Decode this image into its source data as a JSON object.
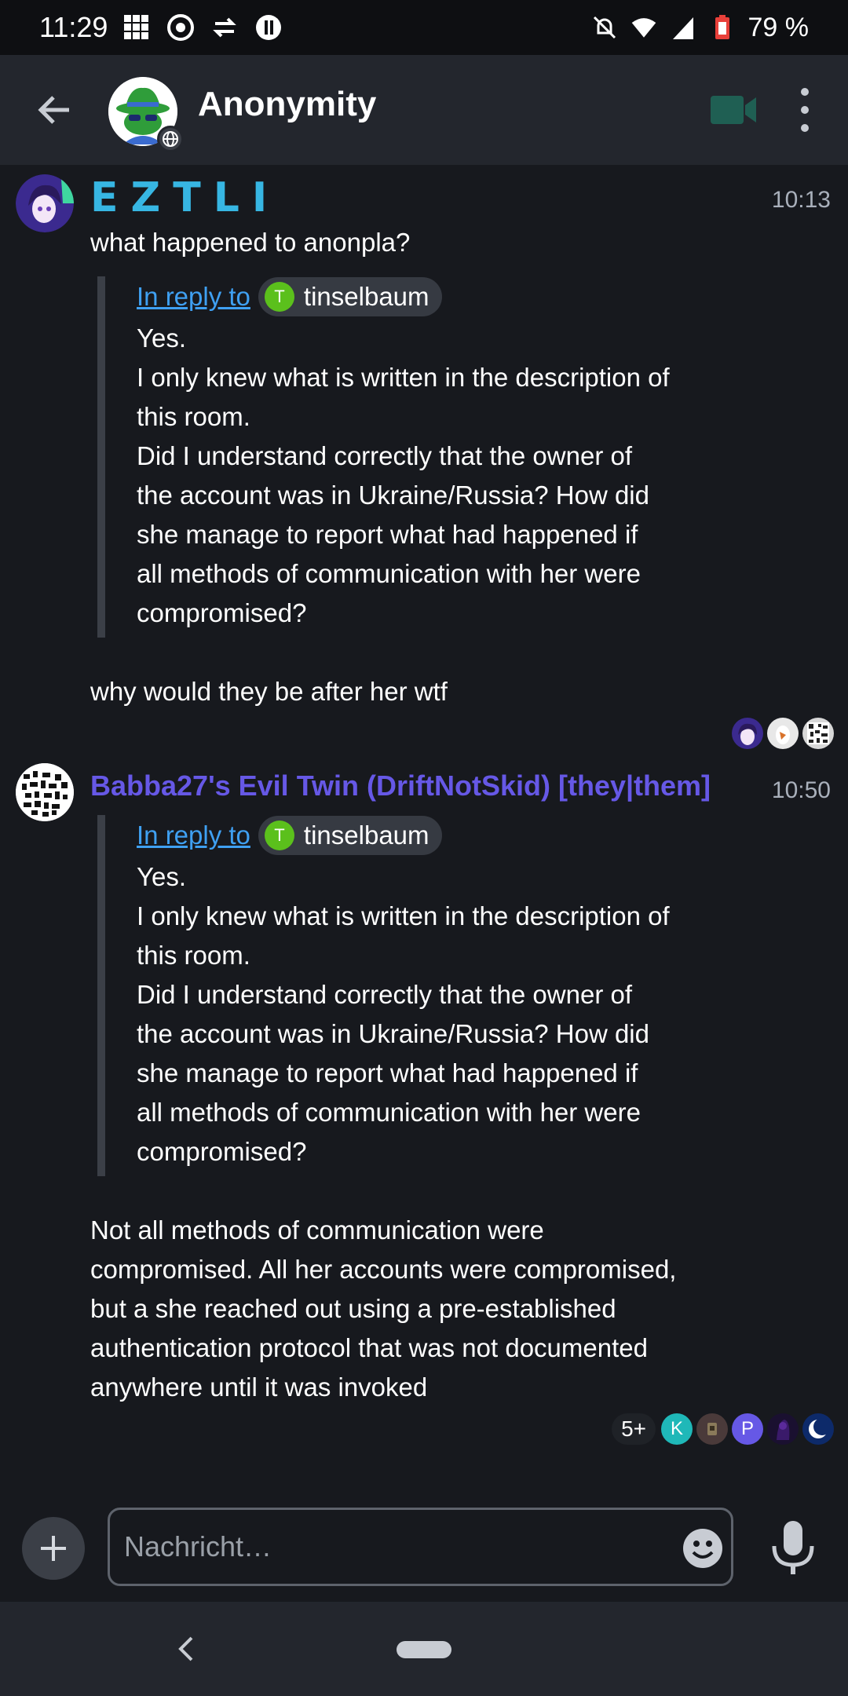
{
  "status_bar": {
    "time": "11:29",
    "battery": "79 %"
  },
  "header": {
    "room_name": "Anonymity",
    "icons": [
      "back-arrow-icon",
      "video-call-icon",
      "more-vert-icon"
    ]
  },
  "messages": [
    {
      "sender": "EZTLI",
      "sender_color": "#37b6e3",
      "time": "10:13",
      "pre_text": "what happened to anonpla?",
      "reply": {
        "link_label": "In reply to",
        "user_initial": "T",
        "user_name": "tinselbaum",
        "text": "Yes.\nI only knew what is written in the description of\nthis room.\nDid I understand correctly that the owner of\nthe account was in Ukraine/Russia? How did\nshe manage to report what had happened if\nall methods of communication with her were\ncompromised?"
      },
      "body": "why would they be after her wtf"
    },
    {
      "sender": "Babba27's Evil Twin (DriftNotSkid) [they|them]",
      "sender_color": "#6658e6",
      "time": "10:50",
      "reply": {
        "link_label": "In reply to",
        "user_initial": "T",
        "user_name": "tinselbaum",
        "text": "Yes.\nI only knew what is written in the description of\nthis room.\nDid I understand correctly that the owner of\nthe account was in Ukraine/Russia? How did\nshe manage to report what had happened if\nall methods of communication with her were\ncompromised?"
      },
      "body": "Not all methods of communication were\ncompromised. All her accounts were compromised,\nbut a she reached out using a pre-established\nauthentication protocol that was not documented\nanywhere until it was invoked",
      "receipts": {
        "more": "5+",
        "initials": [
          "K",
          "P"
        ]
      }
    }
  ],
  "composer": {
    "placeholder": "Nachricht…"
  },
  "colors": {
    "background": "#17191e",
    "header": "#23262d",
    "link": "#3fa0f2",
    "reply_avatar": "#5bc01c"
  }
}
